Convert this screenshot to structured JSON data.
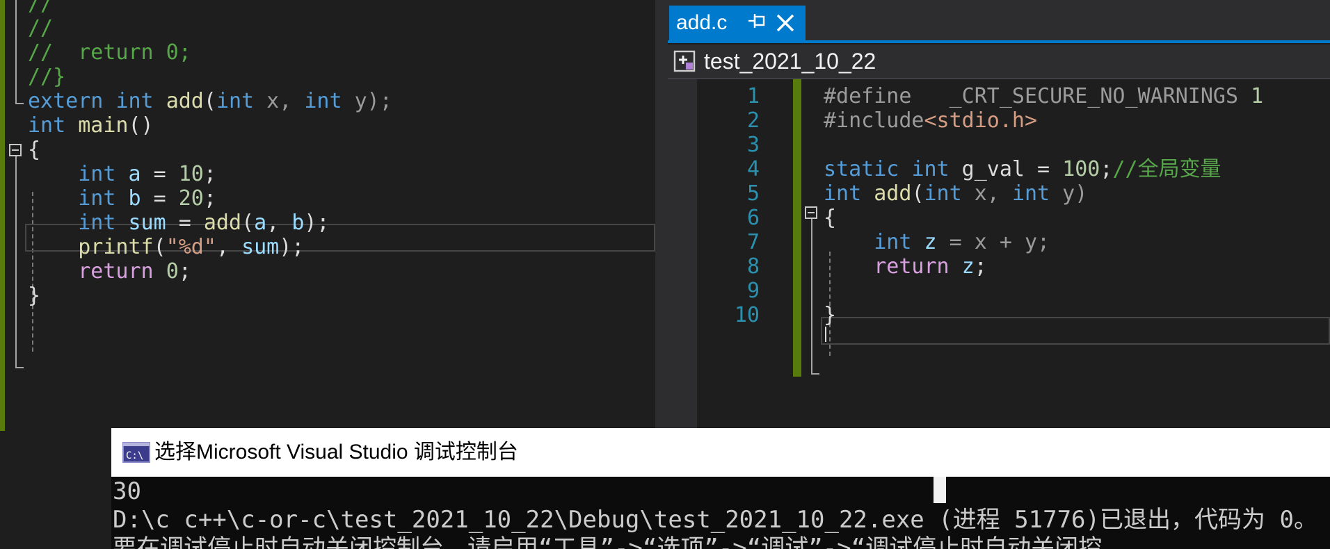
{
  "left_editor": {
    "lines": [
      {
        "parts": [
          {
            "t": "//",
            "c": "cm"
          }
        ]
      },
      {
        "parts": [
          {
            "t": "//",
            "c": "cm"
          }
        ]
      },
      {
        "parts": [
          {
            "t": "//  return 0;",
            "c": "cm"
          }
        ]
      },
      {
        "parts": [
          {
            "t": "//}",
            "c": "cm"
          }
        ]
      },
      {
        "parts": [
          {
            "t": "extern",
            "c": "kw"
          },
          {
            "t": " ",
            "c": ""
          },
          {
            "t": "int",
            "c": "kw"
          },
          {
            "t": " ",
            "c": ""
          },
          {
            "t": "add",
            "c": "fn"
          },
          {
            "t": "(",
            "c": ""
          },
          {
            "t": "int",
            "c": "kw"
          },
          {
            "t": " x, ",
            "c": "pp"
          },
          {
            "t": "int",
            "c": "kw"
          },
          {
            "t": " y);",
            "c": "pp"
          }
        ]
      },
      {
        "parts": [
          {
            "t": "int",
            "c": "kw"
          },
          {
            "t": " ",
            "c": ""
          },
          {
            "t": "main",
            "c": "fn"
          },
          {
            "t": "()",
            "c": ""
          }
        ]
      },
      {
        "parts": [
          {
            "t": "{",
            "c": ""
          }
        ]
      },
      {
        "parts": [
          {
            "t": "    ",
            "c": ""
          },
          {
            "t": "int",
            "c": "kw"
          },
          {
            "t": " ",
            "c": ""
          },
          {
            "t": "a",
            "c": "var"
          },
          {
            "t": " = ",
            "c": ""
          },
          {
            "t": "10",
            "c": "num"
          },
          {
            "t": ";",
            "c": ""
          }
        ]
      },
      {
        "parts": [
          {
            "t": "    ",
            "c": ""
          },
          {
            "t": "int",
            "c": "kw"
          },
          {
            "t": " ",
            "c": ""
          },
          {
            "t": "b",
            "c": "var"
          },
          {
            "t": " = ",
            "c": ""
          },
          {
            "t": "20",
            "c": "num"
          },
          {
            "t": ";",
            "c": ""
          }
        ]
      },
      {
        "parts": [
          {
            "t": "    ",
            "c": ""
          },
          {
            "t": "int",
            "c": "kw"
          },
          {
            "t": " ",
            "c": ""
          },
          {
            "t": "sum",
            "c": "var"
          },
          {
            "t": " = ",
            "c": ""
          },
          {
            "t": "add",
            "c": "fn"
          },
          {
            "t": "(",
            "c": ""
          },
          {
            "t": "a",
            "c": "var"
          },
          {
            "t": ", ",
            "c": ""
          },
          {
            "t": "b",
            "c": "var"
          },
          {
            "t": ");",
            "c": ""
          }
        ]
      },
      {
        "parts": [
          {
            "t": "    ",
            "c": ""
          },
          {
            "t": "printf",
            "c": "fn"
          },
          {
            "t": "(",
            "c": ""
          },
          {
            "t": "\"%d\"",
            "c": "str"
          },
          {
            "t": ", ",
            "c": ""
          },
          {
            "t": "sum",
            "c": "var"
          },
          {
            "t": ");",
            "c": ""
          }
        ]
      },
      {
        "parts": [
          {
            "t": "    ",
            "c": ""
          },
          {
            "t": "return",
            "c": "ctl"
          },
          {
            "t": " ",
            "c": ""
          },
          {
            "t": "0",
            "c": "num"
          },
          {
            "t": ";",
            "c": ""
          }
        ]
      },
      {
        "parts": [
          {
            "t": "}",
            "c": ""
          }
        ]
      }
    ]
  },
  "right_tab": {
    "title": "add.c",
    "pin_icon": "pin-icon",
    "close_icon": "close-icon"
  },
  "nav_bar": {
    "project": "test_2021_10_22",
    "icon": "project-icon"
  },
  "right_editor": {
    "line_numbers": [
      "1",
      "2",
      "3",
      "4",
      "5",
      "6",
      "7",
      "8",
      "9",
      "10"
    ],
    "lines": [
      {
        "parts": [
          {
            "t": "#define",
            "c": "pp"
          },
          {
            "t": "   ",
            "c": ""
          },
          {
            "t": "_CRT_SECURE_NO_WARNINGS",
            "c": "pp"
          },
          {
            "t": " ",
            "c": ""
          },
          {
            "t": "1",
            "c": "num"
          }
        ]
      },
      {
        "parts": [
          {
            "t": "#include",
            "c": "pp"
          },
          {
            "t": "<stdio.h>",
            "c": "inc"
          }
        ]
      },
      {
        "parts": []
      },
      {
        "parts": [
          {
            "t": "static",
            "c": "kw"
          },
          {
            "t": " ",
            "c": ""
          },
          {
            "t": "int",
            "c": "kw"
          },
          {
            "t": " g_val = ",
            "c": ""
          },
          {
            "t": "100",
            "c": "num"
          },
          {
            "t": ";",
            "c": ""
          },
          {
            "t": "//全局变量",
            "c": "cm"
          }
        ]
      },
      {
        "parts": [
          {
            "t": "int",
            "c": "kw"
          },
          {
            "t": " ",
            "c": ""
          },
          {
            "t": "add",
            "c": "fn"
          },
          {
            "t": "(",
            "c": ""
          },
          {
            "t": "int",
            "c": "kw"
          },
          {
            "t": " x, ",
            "c": "pp"
          },
          {
            "t": "int",
            "c": "kw"
          },
          {
            "t": " y)",
            "c": "pp"
          }
        ]
      },
      {
        "parts": [
          {
            "t": "{",
            "c": ""
          }
        ]
      },
      {
        "parts": [
          {
            "t": "    ",
            "c": ""
          },
          {
            "t": "int",
            "c": "kw"
          },
          {
            "t": " ",
            "c": ""
          },
          {
            "t": "z",
            "c": "var"
          },
          {
            "t": " = x + y;",
            "c": "pp"
          }
        ]
      },
      {
        "parts": [
          {
            "t": "    ",
            "c": ""
          },
          {
            "t": "return",
            "c": "ctl"
          },
          {
            "t": " ",
            "c": ""
          },
          {
            "t": "z",
            "c": "var"
          },
          {
            "t": ";",
            "c": ""
          }
        ]
      },
      {
        "parts": []
      },
      {
        "parts": [
          {
            "t": "}",
            "c": ""
          }
        ]
      }
    ]
  },
  "console": {
    "title": "选择Microsoft Visual Studio 调试控制台",
    "icon": "console-icon",
    "lines": [
      "30",
      "D:\\c c++\\c-or-c\\test_2021_10_22\\Debug\\test_2021_10_22.exe (进程 51776)已退出，代码为 0。",
      "要在调试停止时自动关闭控制台，请启用“工具”->“选项”->“调试”->“调试停止时自动关闭控"
    ]
  },
  "colors": {
    "editor_bg": "#1e1e1e",
    "accent": "#007acc",
    "change_bar": "#587c0c",
    "keyword": "#569cd6",
    "comment": "#57a64a",
    "line_number": "#2b91af"
  }
}
